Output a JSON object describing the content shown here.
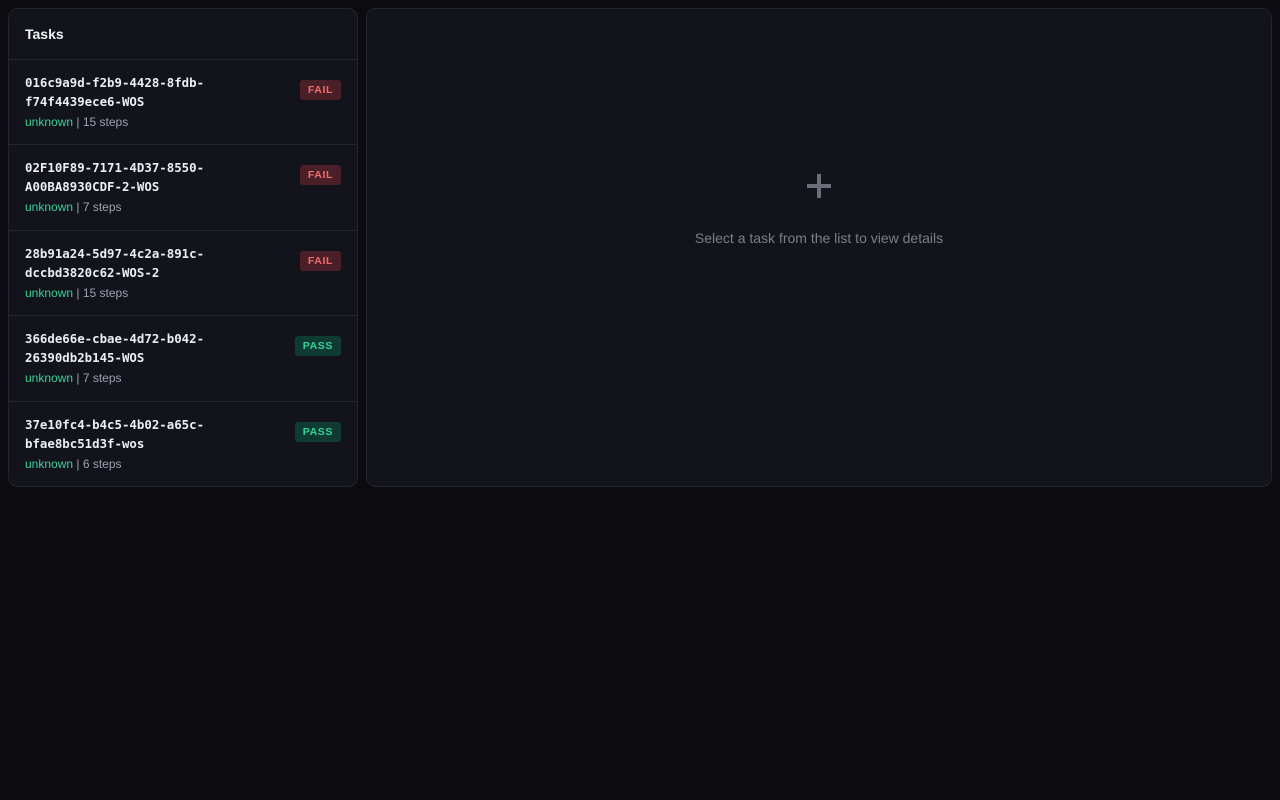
{
  "sidebar": {
    "title": "Tasks",
    "items": [
      {
        "id_line1": "016c9a9d-f2b9-4428-8fdb-",
        "id_line2": "f74f4439ece6-WOS",
        "source": "unknown",
        "steps": "15 steps",
        "status": "FAIL"
      },
      {
        "id_line1": "02F10F89-7171-4D37-8550-",
        "id_line2": "A00BA8930CDF-2-WOS",
        "source": "unknown",
        "steps": "7 steps",
        "status": "FAIL"
      },
      {
        "id_line1": "28b91a24-5d97-4c2a-891c-",
        "id_line2": "dccbd3820c62-WOS-2",
        "source": "unknown",
        "steps": "15 steps",
        "status": "FAIL"
      },
      {
        "id_line1": "366de66e-cbae-4d72-b042-",
        "id_line2": "26390db2b145-WOS",
        "source": "unknown",
        "steps": "7 steps",
        "status": "PASS"
      },
      {
        "id_line1": "37e10fc4-b4c5-4b02-a65c-",
        "id_line2": "bfae8bc51d3f-wos",
        "source": "unknown",
        "steps": "6 steps",
        "status": "PASS"
      }
    ]
  },
  "detail": {
    "icon": "plus-icon",
    "empty_message": "Select a task from the list to view details"
  },
  "separator": " | ",
  "colors": {
    "background": "#0b0b10",
    "panel": "#12131b",
    "border": "#23252f",
    "fail_bg": "#4a1f27",
    "fail_text": "#f26b6b",
    "pass_bg": "#0f3b33",
    "pass_text": "#34d399",
    "source_text": "#34d399"
  }
}
